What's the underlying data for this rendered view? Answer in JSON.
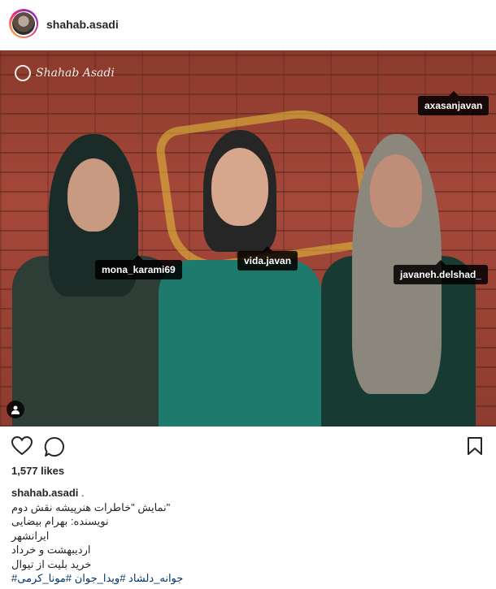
{
  "header": {
    "username": "shahab.asadi"
  },
  "photo": {
    "watermark": "Shahab Asadi",
    "tags": [
      {
        "label": "axasanjavan"
      },
      {
        "label": "mona_karami69"
      },
      {
        "label": "vida.javan"
      },
      {
        "label": "javaneh.delshad_"
      }
    ]
  },
  "actions": {
    "like_icon": "heart-icon",
    "comment_icon": "comment-icon",
    "save_icon": "bookmark-icon"
  },
  "likes": "1,577 likes",
  "caption": {
    "username": "shahab.asadi",
    "separator": " .",
    "lines": [
      "\"نمایش \"خاطرات هنرپیشه نقش دوم",
      "نویسنده: بهرام بیضایی",
      "ایرانشهر",
      "اردیبهشت و خرداد",
      "خرید بلیت از تیوال"
    ],
    "hashtags": "جوانه_دلشاد #ویدا_جوان #مونا_کرمی#"
  }
}
